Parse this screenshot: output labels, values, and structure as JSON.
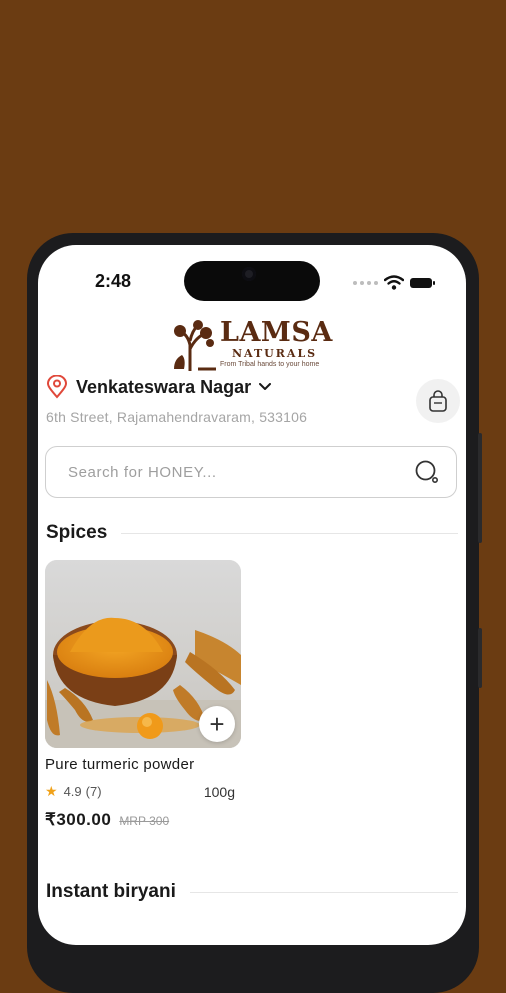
{
  "status": {
    "time": "2:48"
  },
  "brand": {
    "name": "LAMSA",
    "sub": "NATURALS",
    "tagline": "From Tribal hands to your home"
  },
  "location": {
    "name": "Venkateswara Nagar",
    "address": "6th Street, Rajamahendravaram, 533106"
  },
  "search": {
    "placeholder": "Search for HONEY..."
  },
  "sections": [
    {
      "title": "Spices",
      "products": [
        {
          "name": "Pure turmeric powder",
          "rating": "4.9",
          "reviews": "(7)",
          "weight": "100g",
          "price": "₹300.00",
          "mrp": "MRP 300"
        }
      ]
    },
    {
      "title": "Instant biryani"
    }
  ],
  "colors": {
    "background": "#6b3c12",
    "brand": "#5a2b12",
    "pin": "#e0483a",
    "star": "#f0a21a"
  }
}
